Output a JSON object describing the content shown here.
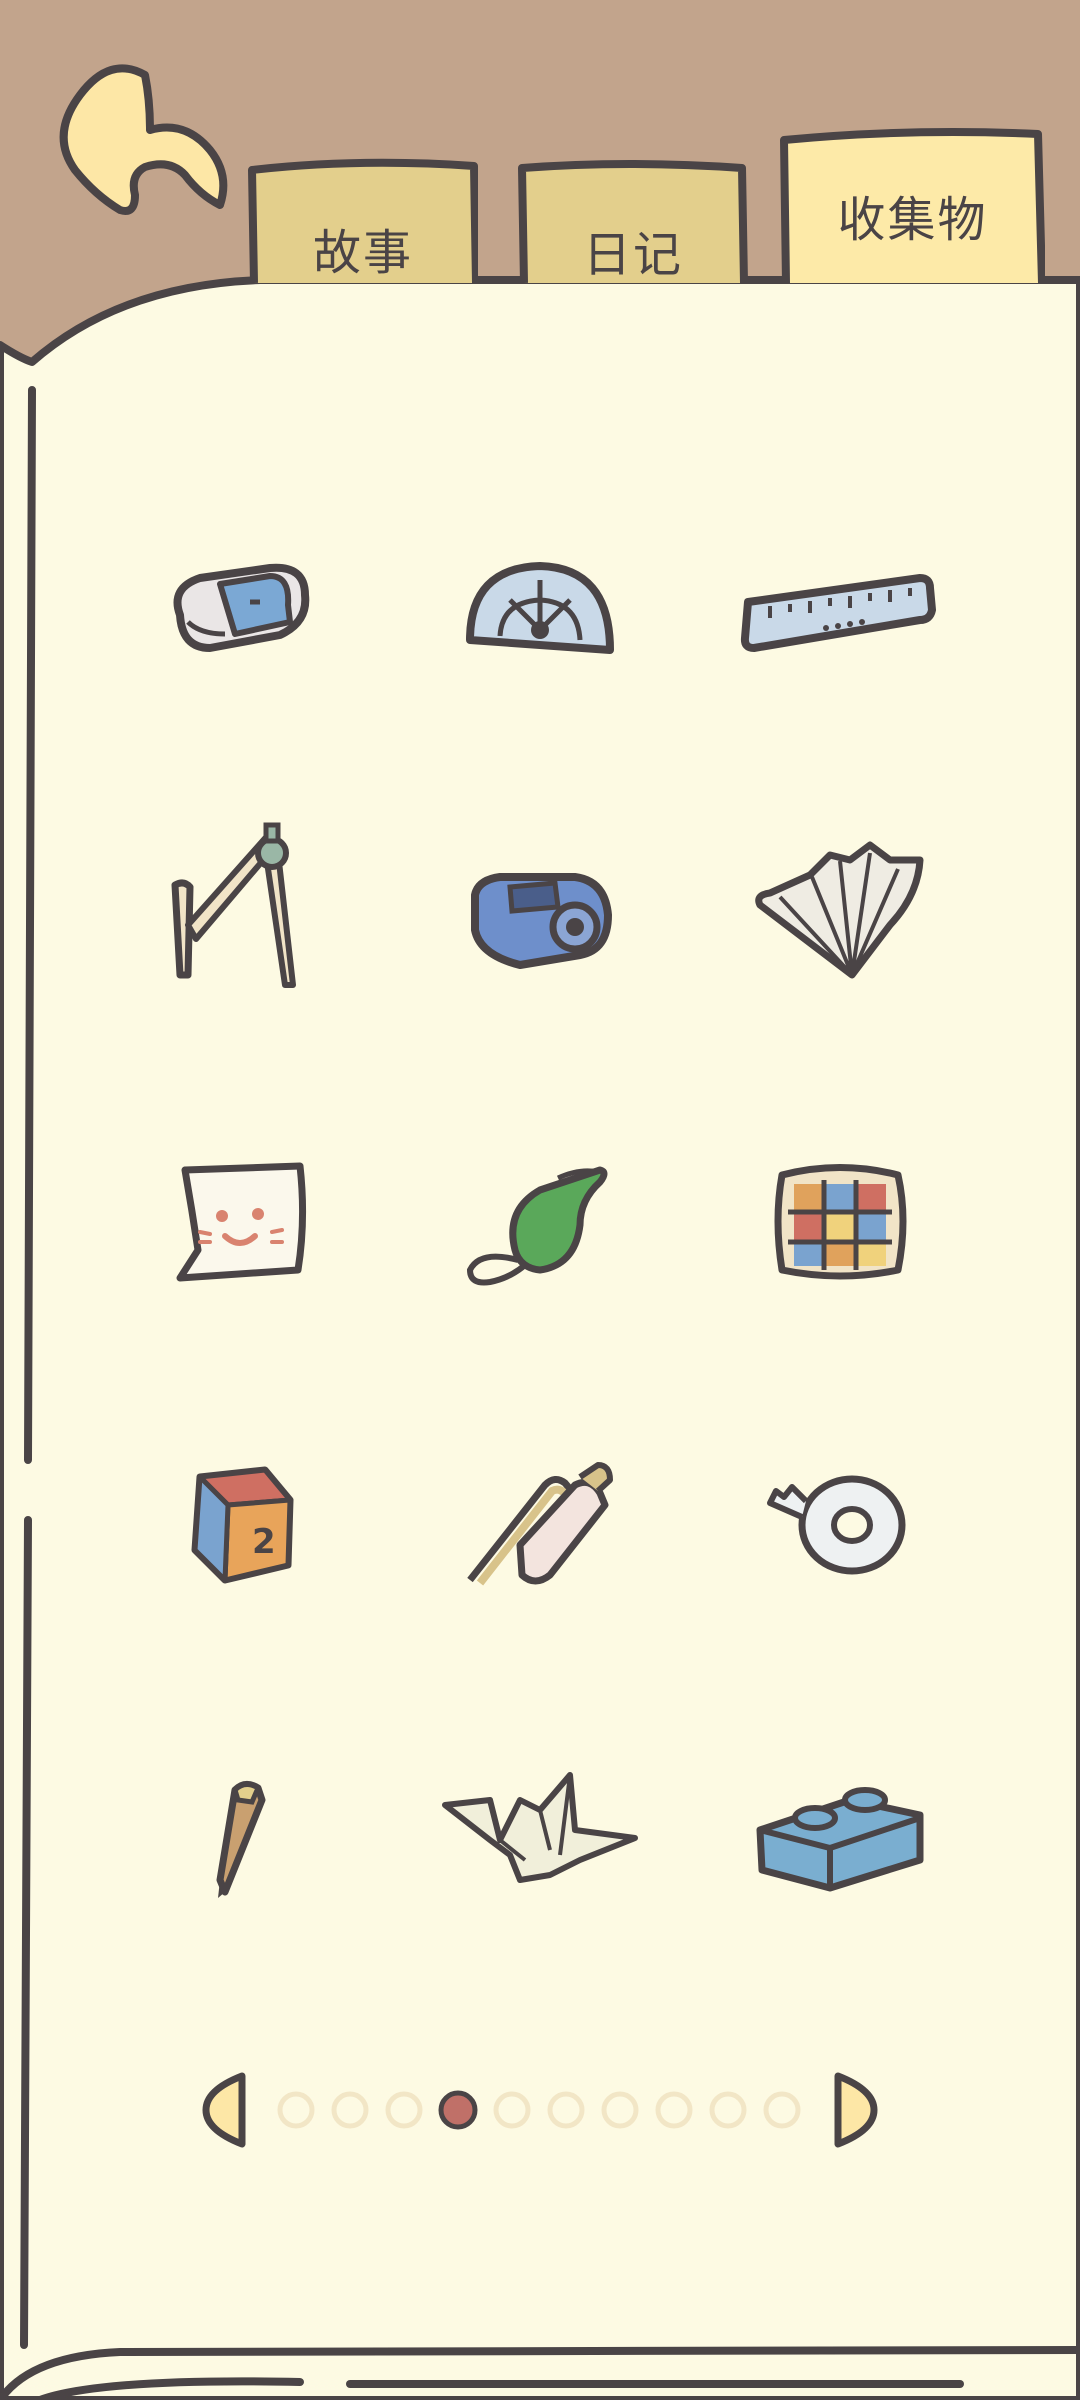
{
  "tabs": [
    {
      "label": "故事",
      "active": false
    },
    {
      "label": "日记",
      "active": false
    },
    {
      "label": "收集物",
      "active": true
    }
  ],
  "collection": {
    "items": [
      {
        "name": "eraser"
      },
      {
        "name": "protractor"
      },
      {
        "name": "ruler"
      },
      {
        "name": "compass"
      },
      {
        "name": "pencil-sharpener"
      },
      {
        "name": "paper-fan"
      },
      {
        "name": "sticky-note-face"
      },
      {
        "name": "whistle"
      },
      {
        "name": "rubiks-cube"
      },
      {
        "name": "number-dice"
      },
      {
        "name": "glue-stick"
      },
      {
        "name": "tape-roll"
      },
      {
        "name": "pencil-stub"
      },
      {
        "name": "paper-crane"
      },
      {
        "name": "toy-brick"
      }
    ]
  },
  "pagination": {
    "total_pages": 10,
    "current_page": 4
  },
  "colors": {
    "background": "#c2a48c",
    "page": "#fdfae3",
    "tab": "#e3cf8c",
    "tab_active": "#fdeaa8",
    "outline": "#4a4446",
    "dot_active": "#c07068",
    "dot_inactive": "#f2e6c6"
  }
}
